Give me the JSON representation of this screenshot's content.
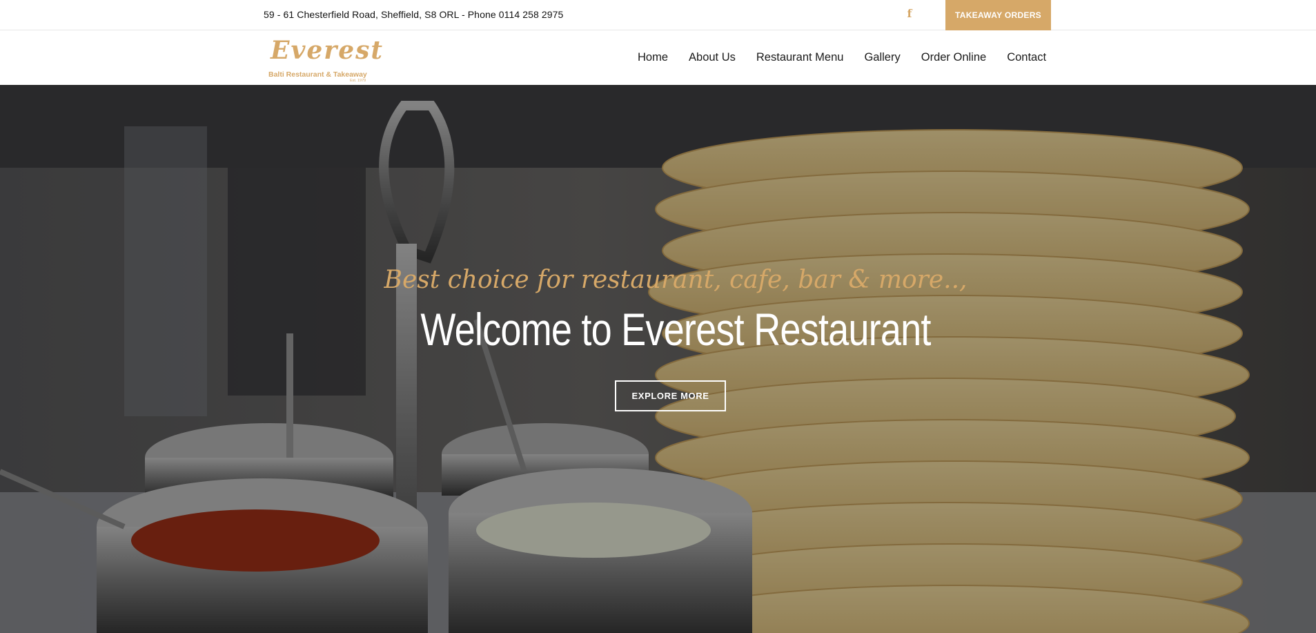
{
  "colors": {
    "accent": "#d6a868"
  },
  "topbar": {
    "address": "59 - 61 Chesterfield Road, Sheffield, S8 ORL - Phone 0114 258 2975",
    "social_icon": "facebook-icon",
    "facebook_glyph": "f",
    "takeaway_label": "TAKEAWAY ORDERS"
  },
  "logo": {
    "name": "Everest",
    "tagline": "Balti Restaurant & Takeaway",
    "est": "Est. 1979"
  },
  "nav": {
    "items": [
      {
        "label": "Home"
      },
      {
        "label": "About Us"
      },
      {
        "label": "Restaurant Menu"
      },
      {
        "label": "Gallery"
      },
      {
        "label": "Order Online"
      },
      {
        "label": "Contact"
      }
    ]
  },
  "hero": {
    "tagline": "Best choice for restaurant, cafe, bar & more..,",
    "headline": "Welcome to Everest Restaurant",
    "cta_label": "EXPLORE MORE"
  }
}
